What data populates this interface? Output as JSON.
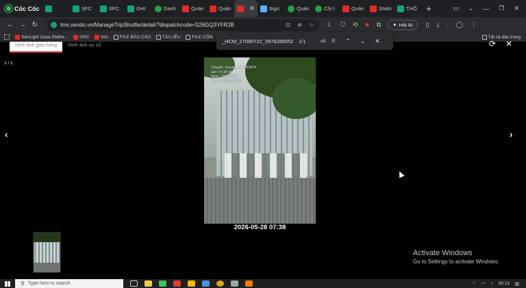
{
  "browser": {
    "brand": "Cốc Cốc",
    "tabs": [
      {
        "label": "",
        "icon": "green",
        "active": false
      },
      {
        "label": "SFC",
        "icon": "green",
        "active": false
      },
      {
        "label": "SFC",
        "icon": "green",
        "active": false
      },
      {
        "label": "GHI",
        "icon": "green",
        "active": false
      },
      {
        "label": "Danh",
        "icon": "circ",
        "active": false
      },
      {
        "label": "Quản",
        "icon": "red",
        "active": false
      },
      {
        "label": "Quản",
        "icon": "red",
        "active": false
      },
      {
        "label": "",
        "icon": "red",
        "active": true
      },
      {
        "label": "Sign",
        "icon": "blue",
        "active": false
      },
      {
        "label": "Quản",
        "icon": "circ",
        "active": false
      },
      {
        "label": "Chi t",
        "icon": "circ",
        "active": false
      },
      {
        "label": "Quản",
        "icon": "red",
        "active": false
      },
      {
        "label": "Statis",
        "icon": "red",
        "active": false
      },
      {
        "label": "THÔ",
        "icon": "green",
        "active": false
      }
    ],
    "url": "tms.sendo.vn/ManageTripShuttle/detail/?dispatchcode=S26GQ3YFR2B",
    "ai_button": "Hỏi AI",
    "bookmarks": [
      {
        "label": "SenLight Case Platfor...",
        "icon": "red"
      },
      {
        "label": "OPC",
        "icon": "red"
      },
      {
        "label": "tms",
        "icon": "red"
      },
      {
        "label": "FILE BÁO CÁO",
        "icon": "folder"
      },
      {
        "label": "TÀI LIỆU",
        "icon": "folder"
      },
      {
        "label": "FILE CÔN",
        "icon": "folder"
      }
    ],
    "all_bookmarks": "Tất cả dấu trang"
  },
  "find_bar": {
    "query": "_HCM_27090722_0976285552",
    "count": "1/1",
    "case_label": "ab"
  },
  "viewer": {
    "tabs": [
      "Hình ảnh giao hàng",
      "Hình ảnh sự cố"
    ],
    "counter": "1 / 1",
    "prev_arrow": "‹",
    "next_arrow": "›",
    "stamp": {
      "line1": "Chuyến: chuyen_12_IP61674",
      "line2": "Giờ: 07:38:38",
      "line3": "Ngày: 28/05/2026",
      "line4": "Tài xế: 0393184730"
    },
    "caption": "2026-05-28 07:38"
  },
  "activation": {
    "title": "Activate Windows",
    "subtitle": "Go to Settings to activate Windows."
  },
  "taskbar": {
    "search_placeholder": "Type here to search",
    "time": "20:13",
    "date": ""
  }
}
